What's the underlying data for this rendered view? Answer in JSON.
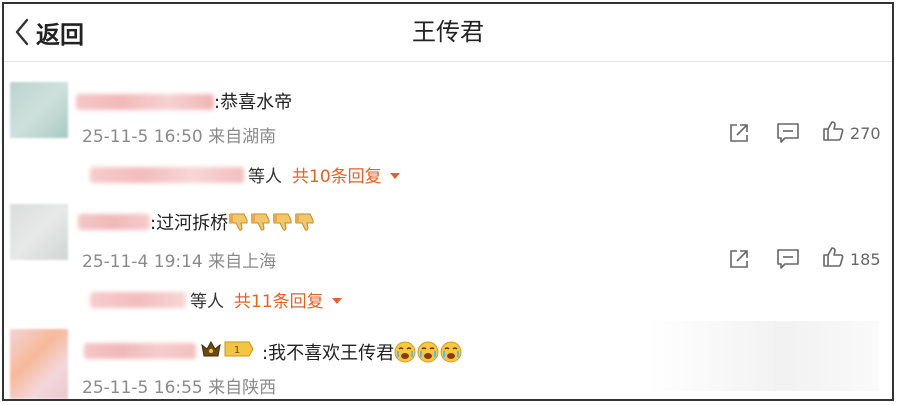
{
  "header": {
    "back_label": "返回",
    "title": "王传君"
  },
  "comments": [
    {
      "text": ":恭喜水帝",
      "meta": "25-11-5 16:50 来自湖南",
      "replies_suffix": "等人",
      "replies_count": "共10条回复",
      "likes": "270"
    },
    {
      "text": ":过河拆桥",
      "meta": "25-11-4 19:14 来自上海",
      "replies_suffix": "等人",
      "replies_count": "共11条回复",
      "likes": "185"
    },
    {
      "text": ":我不喜欢王传君",
      "meta": "25-11-5 16:55 来自陕西",
      "badge_level": "1"
    }
  ],
  "icons": {
    "back": "chevron-left-icon",
    "share": "share-icon",
    "comment": "comment-icon",
    "like": "thumbs-up-icon",
    "thumbs_down_emoji": "thumbs-down-emoji",
    "crying_face_emoji": "crying-face-emoji",
    "crown": "crown-icon"
  },
  "colors": {
    "accent": "#e1622b",
    "meta_text": "#8a8a8a",
    "border": "#333333"
  }
}
